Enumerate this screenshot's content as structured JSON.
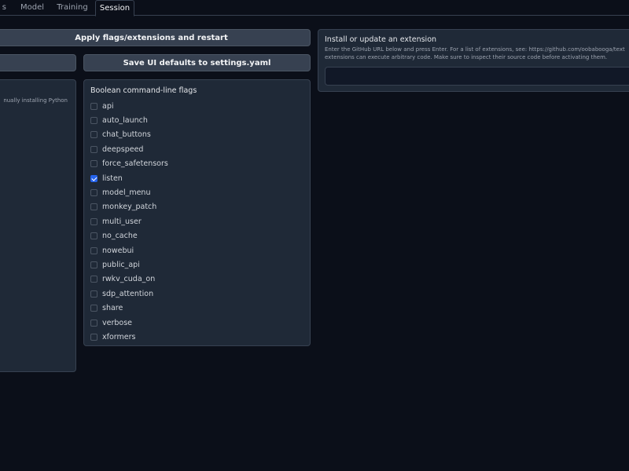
{
  "tabs": [
    {
      "label": "s",
      "active": false
    },
    {
      "label": "Model",
      "active": false
    },
    {
      "label": "Training",
      "active": false
    },
    {
      "label": "Session",
      "active": true
    }
  ],
  "buttons": {
    "apply_label": "Apply flags/extensions and restart",
    "save_label": "Save UI defaults to settings.yaml"
  },
  "left_panel": {
    "text": "nually installing Python"
  },
  "flags": {
    "title": "Boolean command-line flags",
    "items": [
      {
        "label": "api",
        "checked": false
      },
      {
        "label": "auto_launch",
        "checked": false
      },
      {
        "label": "chat_buttons",
        "checked": false
      },
      {
        "label": "deepspeed",
        "checked": false
      },
      {
        "label": "force_safetensors",
        "checked": false
      },
      {
        "label": "listen",
        "checked": true
      },
      {
        "label": "model_menu",
        "checked": false
      },
      {
        "label": "monkey_patch",
        "checked": false
      },
      {
        "label": "multi_user",
        "checked": false
      },
      {
        "label": "no_cache",
        "checked": false
      },
      {
        "label": "nowebui",
        "checked": false
      },
      {
        "label": "public_api",
        "checked": false
      },
      {
        "label": "rwkv_cuda_on",
        "checked": false
      },
      {
        "label": "sdp_attention",
        "checked": false
      },
      {
        "label": "share",
        "checked": false
      },
      {
        "label": "verbose",
        "checked": false
      },
      {
        "label": "xformers",
        "checked": false
      }
    ]
  },
  "extension": {
    "title": "Install or update an extension",
    "description": "Enter the GitHub URL below and press Enter. For a list of extensions, see: https://github.com/oobabooga/text extensions can execute arbitrary code. Make sure to inspect their source code before activating them.",
    "input_value": ""
  },
  "colors": {
    "background": "#0b0f19",
    "panel": "#1f2937",
    "button": "#374151",
    "accent": "#2563eb"
  }
}
